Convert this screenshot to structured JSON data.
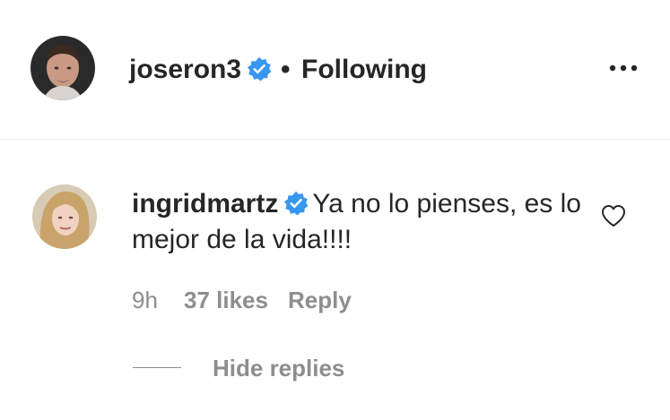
{
  "post_header": {
    "username": "joseron3",
    "separator": "•",
    "following_label": "Following",
    "avatar_icon": "profile-photo-joseron3",
    "more_icon": "more-options-icon"
  },
  "comment": {
    "author": "ingridmartz",
    "text": "Ya no lo pienses, es lo mejor de la vida!!!!",
    "time": "9h",
    "likes": "37 likes",
    "reply_label": "Reply",
    "hide_replies_label": "Hide replies",
    "avatar_icon": "profile-photo-ingridmartz",
    "like_icon": "heart-outline-icon"
  },
  "colors": {
    "text_primary": "#262626",
    "text_secondary": "#8e8e8e",
    "verified_blue": "#3897f0",
    "divider": "#efefef"
  }
}
